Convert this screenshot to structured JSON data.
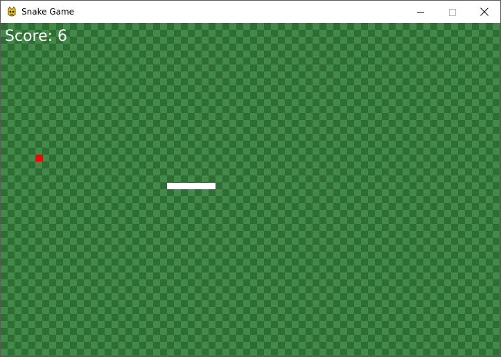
{
  "window": {
    "title": "Snake Game",
    "icon": "pygame-snake-icon",
    "controls": {
      "minimize": "minimize-icon",
      "maximize": "maximize-icon",
      "close": "close-icon"
    }
  },
  "game": {
    "score_text": "Score: 6",
    "colors": {
      "board_dark": "#2f6e33",
      "board_light": "#438a4a",
      "snake": "#ffffff",
      "food": "#ff0000"
    },
    "snake_segments": 7,
    "food_visible": true
  }
}
